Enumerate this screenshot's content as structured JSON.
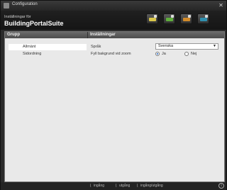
{
  "window": {
    "title": "Configuration",
    "close_glyph": "✕"
  },
  "header": {
    "subtitle": "Inställningar för",
    "brand": "BuildingPortalSuite"
  },
  "toolbar": {
    "buttons": [
      {
        "name": "tool-button-1",
        "icon": "card-yellow-icon",
        "color": "#d9c64a"
      },
      {
        "name": "tool-button-2",
        "icon": "card-green-icon",
        "color": "#5fae3c"
      },
      {
        "name": "tool-button-3",
        "icon": "card-orange-icon",
        "color": "#d18a2a"
      },
      {
        "name": "tool-button-4",
        "icon": "card-teal-icon",
        "color": "#2f8fae"
      }
    ]
  },
  "left": {
    "header": "Grupp",
    "items": [
      {
        "label": "Allmänt",
        "selected": true
      },
      {
        "label": "Sidordning",
        "selected": false
      }
    ]
  },
  "right": {
    "header": "Inställningar",
    "language_label": "Språk",
    "language_value": "Svenska",
    "fill_label": "Fyll bakgrund vid zoom",
    "option_yes": "Ja",
    "option_no": "Nej",
    "selected": "Ja"
  },
  "footer": {
    "legend": [
      "ingång",
      "utgång",
      "ingång/utgång"
    ],
    "info_glyph": "i"
  }
}
